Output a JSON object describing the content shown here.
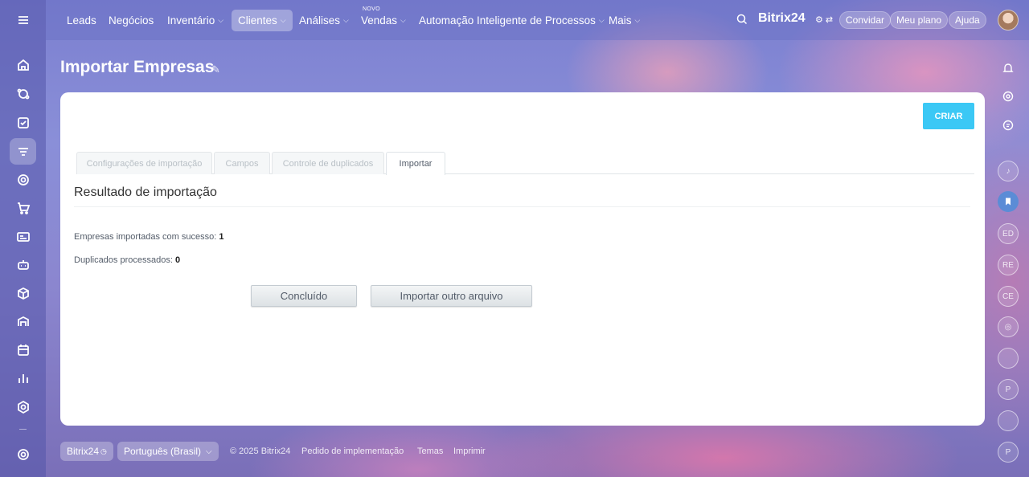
{
  "nav": {
    "items": [
      {
        "label": "Leads",
        "has_dropdown": false
      },
      {
        "label": "Negócios",
        "has_dropdown": false
      },
      {
        "label": "Inventário",
        "has_dropdown": true
      },
      {
        "label": "Clientes",
        "has_dropdown": true,
        "active": true
      },
      {
        "label": "Análises",
        "has_dropdown": true
      },
      {
        "label": "Vendas",
        "has_dropdown": true,
        "badge": "NOVO"
      },
      {
        "label": "Automação Inteligente de Processos",
        "has_dropdown": true
      },
      {
        "label": "Mais",
        "has_dropdown": true
      }
    ],
    "brand": "Bitrix24",
    "invite_label": "Convidar",
    "plan_label": "Meu plano",
    "help_label": "Ajuda"
  },
  "page": {
    "title": "Importar Empresas"
  },
  "card": {
    "create_label": "CRIAR",
    "tabs": [
      {
        "label": "Configurações de importação"
      },
      {
        "label": "Campos"
      },
      {
        "label": "Controle de duplicados"
      },
      {
        "label": "Importar",
        "active": true
      }
    ],
    "section_title": "Resultado de importação",
    "stats": [
      {
        "label": "Empresas importadas com sucesso:",
        "value": "1"
      },
      {
        "label": "Duplicados processados:",
        "value": "0"
      }
    ],
    "done_label": "Concluído",
    "import_another_label": "Importar outro arquivo"
  },
  "right_rail": {
    "initials": [
      "ED",
      "RE",
      "CE",
      "P",
      "P"
    ]
  },
  "footer": {
    "brand": "Bitrix24",
    "language": "Português (Brasil)",
    "copyright": "© 2025 Bitrix24",
    "links": [
      "Pedido de implementação",
      "Temas",
      "Imprimir"
    ]
  },
  "colors": {
    "accent": "#3bc8f5",
    "sidebar_bg": "#5456aa"
  }
}
